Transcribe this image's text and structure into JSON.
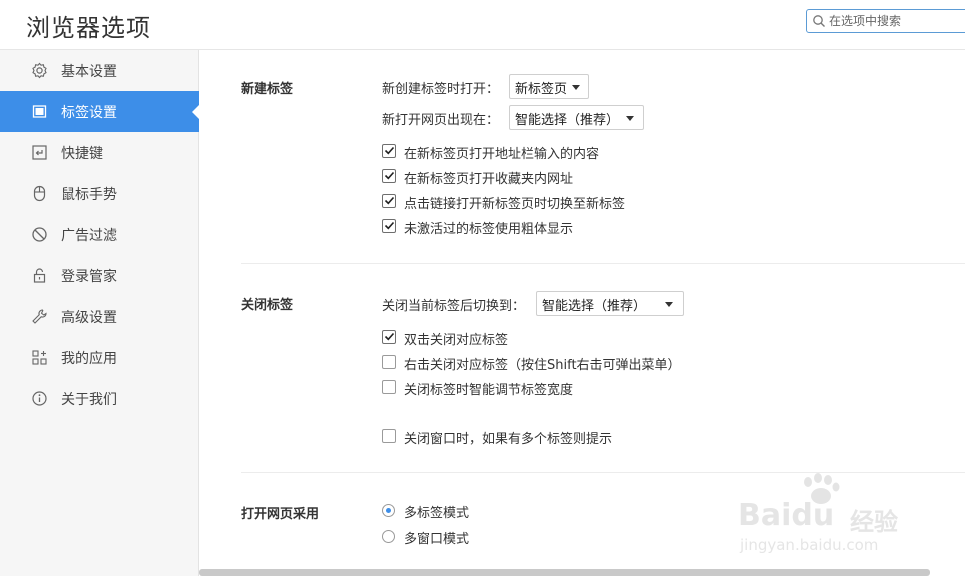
{
  "header": {
    "title": "浏览器选项",
    "search_placeholder": "在选项中搜索"
  },
  "sidebar": {
    "items": [
      {
        "label": "基本设置",
        "icon": "gear-icon",
        "active": false
      },
      {
        "label": "标签设置",
        "icon": "tab-icon",
        "active": true
      },
      {
        "label": "快捷键",
        "icon": "shortcut-icon",
        "active": false
      },
      {
        "label": "鼠标手势",
        "icon": "mouse-icon",
        "active": false
      },
      {
        "label": "广告过滤",
        "icon": "block-icon",
        "active": false
      },
      {
        "label": "登录管家",
        "icon": "lock-icon",
        "active": false
      },
      {
        "label": "高级设置",
        "icon": "wrench-icon",
        "active": false
      },
      {
        "label": "我的应用",
        "icon": "apps-icon",
        "active": false
      },
      {
        "label": "关于我们",
        "icon": "info-icon",
        "active": false
      }
    ]
  },
  "new_tab": {
    "title": "新建标签",
    "open_label": "新创建标签时打开：",
    "open_value": "新标签页",
    "position_label": "新打开网页出现在：",
    "position_value": "智能选择（推荐）",
    "options": [
      {
        "label": "在新标签页打开地址栏输入的内容",
        "checked": true
      },
      {
        "label": "在新标签页打开收藏夹内网址",
        "checked": true
      },
      {
        "label": "点击链接打开新标签页时切换至新标签",
        "checked": true
      },
      {
        "label": "未激活过的标签使用粗体显示",
        "checked": true
      }
    ]
  },
  "close_tab": {
    "title": "关闭标签",
    "switch_label": "关闭当前标签后切换到：",
    "switch_value": "智能选择（推荐）",
    "options": [
      {
        "label": "双击关闭对应标签",
        "checked": true
      },
      {
        "label": "右击关闭对应标签（按住Shift右击可弹出菜单）",
        "checked": false
      },
      {
        "label": "关闭标签时智能调节标签宽度",
        "checked": false
      },
      {
        "label": "关闭窗口时，如果有多个标签则提示",
        "checked": false
      }
    ]
  },
  "open_mode": {
    "title": "打开网页采用",
    "options": [
      {
        "label": "多标签模式",
        "checked": true
      },
      {
        "label": "多窗口模式",
        "checked": false
      }
    ]
  },
  "watermark": {
    "brand": "Baidu",
    "brand_cn": "经验",
    "url": "jingyan.baidu.com"
  },
  "colors": {
    "accent": "#3d8ee8",
    "search_border": "#5b9bd5"
  }
}
